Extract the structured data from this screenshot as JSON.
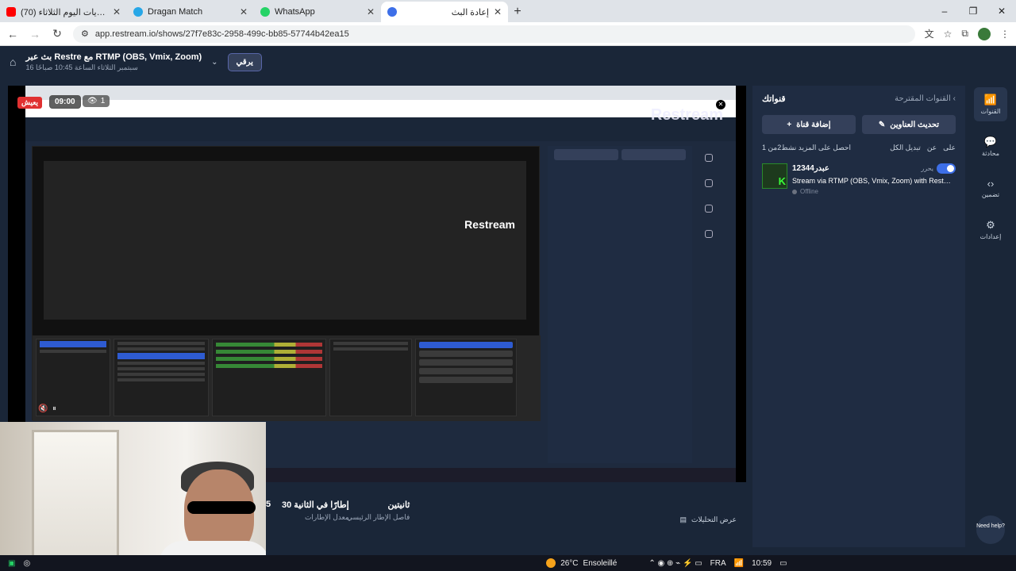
{
  "browser": {
    "tabs": [
      {
        "title": "(70) توقعات مباريات اليوم الثلاثاء",
        "color": "#ff0000",
        "active": false
      },
      {
        "title": "Dragan Match",
        "color": "#27a7e7",
        "active": false
      },
      {
        "title": "WhatsApp",
        "color": "#25d366",
        "active": false
      },
      {
        "title": "إعادة البث",
        "color": "#3d6fe8",
        "active": true
      }
    ],
    "url": "app.restream.io/shows/27f7e83c-2958-499c-bb85-57744b42ea15",
    "new_tab": "+",
    "window_controls": [
      "–",
      "❐",
      "✕"
    ]
  },
  "header": {
    "title": "بث عبر Restre مع RTMP (OBS, Vmix, Zoom)",
    "date": "16 سبتمبر الثلاثاء الساعة 10:45 صباحًا",
    "live_button": "يرقي"
  },
  "stage": {
    "live_badge": "يعيش",
    "timer": "09:00",
    "viewers": "1",
    "watermark": "Restream",
    "inner_watermark": "Restream"
  },
  "stats": {
    "items": [
      {
        "value": "ثانيتين",
        "key": "فاصل الإطار الرئيسي"
      },
      {
        "value": "30 إطارًا في الثانية",
        "key": "معدل الإطارات"
      },
      {
        "value": "5",
        "key": ""
      }
    ],
    "analytics": "عرض التحليلات"
  },
  "panel": {
    "title": "قنواتك",
    "suggested": "القنوات المقترحة",
    "add_channel": "إضافة قناة",
    "update_titles": "تحديث العناوين",
    "count_label": "احصل على المزيد  نشط2من 1",
    "links": [
      "تبديل الكل",
      "عن",
      "على"
    ],
    "channel": {
      "name": "عبدر12344",
      "edit": "يحرر",
      "description": "Stream via RTMP (OBS, Vmix, Zoom) with Restream",
      "status": "Offline",
      "thumb_letter": "K"
    }
  },
  "sidebar": {
    "items": [
      {
        "icon": "📶",
        "label": "القنوات"
      },
      {
        "icon": "💬",
        "label": "محادثة"
      },
      {
        "icon": "‹›",
        "label": "تضمين"
      },
      {
        "icon": "⚙",
        "label": "إعدادات"
      }
    ],
    "help": "Need help?"
  },
  "taskbar": {
    "temp": "26°C",
    "weather": "Ensoleillé",
    "lang": "FRA",
    "time": "10:59"
  }
}
